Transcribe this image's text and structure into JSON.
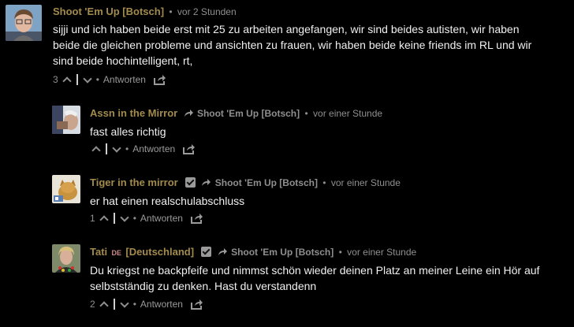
{
  "comments": [
    {
      "author": "Shoot 'Em Up [Botsch]",
      "time": "vor 2 Stunden",
      "text": "sijji und ich haben beide erst mit 25 zu arbeiten angefangen, wir sind beides autisten, wir haben beide die gleichen probleme und ansichten zu frauen, wir haben beide keine friends im RL und wir sind beide hochintelligent, rt,",
      "votes": "3",
      "reply_label": "Antworten"
    },
    {
      "author": "Assn in the Mirror",
      "reply_to": "Shoot 'Em Up [Botsch]",
      "time": "vor einer Stunde",
      "text": "fast alles richtig",
      "votes": "",
      "reply_label": "Antworten"
    },
    {
      "author": "Tiger in the mirror",
      "reply_to": "Shoot 'Em Up [Botsch]",
      "time": "vor einer Stunde",
      "text": "er hat einen realschulabschluss",
      "votes": "1",
      "reply_label": "Antworten"
    },
    {
      "author": "Tati",
      "flag": "DE",
      "author_suffix": "[Deutschland]",
      "reply_to": "Shoot 'Em Up [Botsch]",
      "time": "vor einer Stunde",
      "text": "Du kriegst ne backpfeife und nimmst schön wieder deinen Platz an meiner Leine ein Hör auf selbstständig zu denken. Hast du verstandenn",
      "votes": "2",
      "reply_label": "Antworten"
    }
  ],
  "separator": "•",
  "colors": {
    "background": "#000000",
    "author": "#a28b4c",
    "meta": "#8f8f8f",
    "text": "#f0f0f0"
  }
}
